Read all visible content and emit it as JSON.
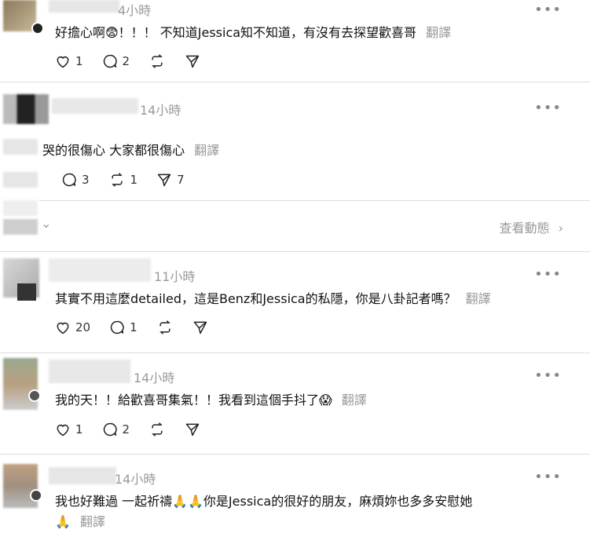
{
  "posts": [
    {
      "time": "4小時",
      "text": "好擔心啊😨！！！ 不知道Jessica知不知道，有沒有去探望歡喜哥",
      "translate": "翻譯",
      "likes": "1",
      "comments": "2",
      "reposts": "",
      "shares": ""
    },
    {
      "time": "14小時",
      "text": "哭的很傷心 大家都很傷心",
      "translate": "翻譯",
      "likes": "",
      "comments": "3",
      "reposts": "1",
      "shares": "7",
      "view_activity": "查看動態"
    },
    {
      "time": "11小時",
      "text": "其實不用這麼detailed，這是Benz和Jessica的私隱，你是八卦記者嗎？",
      "translate": "翻譯",
      "likes": "20",
      "comments": "1",
      "reposts": "",
      "shares": ""
    },
    {
      "time": "14小時",
      "text": "我的天！！給歡喜哥集氣！！我看到這個手抖了😱",
      "translate": "翻譯",
      "likes": "1",
      "comments": "2",
      "reposts": "",
      "shares": ""
    },
    {
      "time": "14小時",
      "text": "我也好難過 一起祈禱🙏🙏你是Jessica的很好的朋友，麻煩妳也多多安慰她",
      "text_line2": "🙏",
      "translate": "翻譯"
    }
  ],
  "more_glyph": "•••",
  "chevron_glyph": "⌄",
  "arrow_glyph": "›",
  "icons": {
    "like": "heart-icon",
    "comment": "comment-icon",
    "repost": "repost-icon",
    "share": "share-icon",
    "more": "more-icon"
  },
  "colors": {
    "text": "#111111",
    "muted": "#999999",
    "divider": "#dcdcdc"
  }
}
